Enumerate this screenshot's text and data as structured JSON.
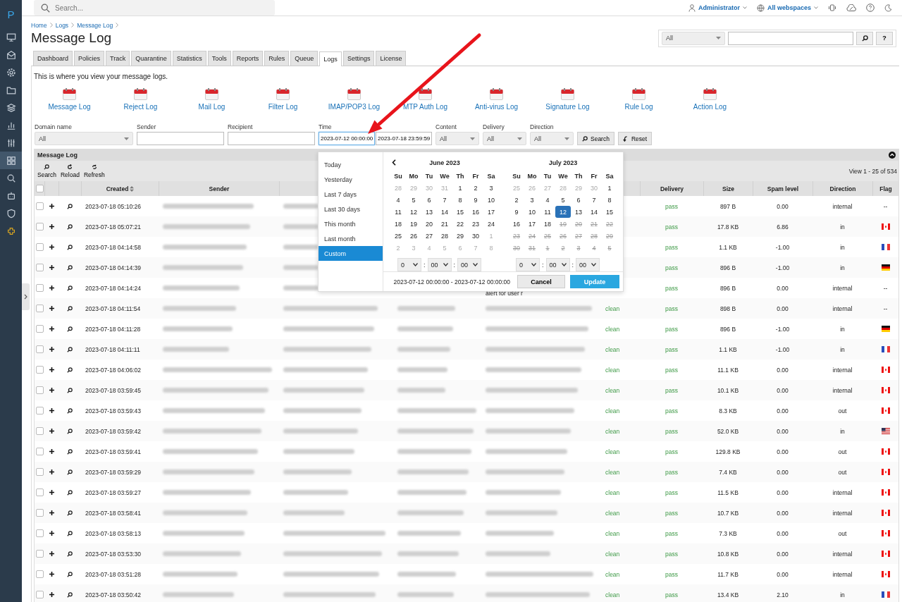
{
  "sidebar": {
    "logo": "P",
    "items": [
      {
        "kind": "monitor",
        "selected": false
      },
      {
        "kind": "inbox",
        "selected": false
      },
      {
        "kind": "gear",
        "selected": false
      },
      {
        "kind": "folder",
        "selected": false
      },
      {
        "kind": "layers",
        "selected": false
      },
      {
        "kind": "chart",
        "selected": false
      },
      {
        "kind": "sliders",
        "selected": false
      },
      {
        "kind": "grid",
        "selected": true
      },
      {
        "kind": "search",
        "selected": false
      },
      {
        "kind": "robot",
        "selected": false
      },
      {
        "kind": "shield",
        "selected": false
      },
      {
        "kind": "puzzle",
        "selected": false
      }
    ]
  },
  "topbar": {
    "search": {
      "placeholder": "Search..."
    },
    "user": "Administrator",
    "webspace": "All webspaces"
  },
  "breadcrumb": [
    "Home",
    "Logs",
    "Message Log"
  ],
  "title": "Message Log",
  "quick_search": {
    "scope": "All",
    "help": "?"
  },
  "tabs": [
    {
      "label": "Dashboard",
      "selected": false
    },
    {
      "label": "Policies",
      "selected": false
    },
    {
      "label": "Track",
      "selected": false
    },
    {
      "label": "Quarantine",
      "selected": false
    },
    {
      "label": "Statistics",
      "selected": false
    },
    {
      "label": "Tools",
      "selected": false
    },
    {
      "label": "Reports",
      "selected": false
    },
    {
      "label": "Rules",
      "selected": false
    },
    {
      "label": "Queue",
      "selected": false
    },
    {
      "label": "Logs",
      "selected": true
    },
    {
      "label": "Settings",
      "selected": false
    },
    {
      "label": "License",
      "selected": false
    }
  ],
  "intro": "This is where you view your message logs.",
  "log_types": [
    "Message Log",
    "Reject Log",
    "Mail Log",
    "Filter Log",
    "IMAP/POP3 Log",
    "MTP Auth Log",
    "Anti-virus Log",
    "Signature Log",
    "Rule Log",
    "Action Log"
  ],
  "filters": {
    "domain": {
      "label": "Domain name",
      "value": "All"
    },
    "sender": {
      "label": "Sender"
    },
    "recipient": {
      "label": "Recipient"
    },
    "time": {
      "label": "Time",
      "from": "2023-07-12 00:00:00",
      "to": "2023-07-18 23:59:59"
    },
    "content": {
      "label": "Content",
      "value": "All"
    },
    "delivery": {
      "label": "Delivery",
      "value": "All"
    },
    "direction": {
      "label": "Direction",
      "value": "All"
    },
    "search_button": "Search",
    "reset_button": "Reset"
  },
  "date_picker": {
    "presets": [
      {
        "label": "Today",
        "selected": false
      },
      {
        "label": "Yesterday",
        "selected": false
      },
      {
        "label": "Last 7 days",
        "selected": false
      },
      {
        "label": "Last 30 days",
        "selected": false
      },
      {
        "label": "This month",
        "selected": false
      },
      {
        "label": "Last month",
        "selected": false
      },
      {
        "label": "Custom",
        "selected": true
      }
    ],
    "months": [
      {
        "title": "June 2023",
        "weekdays": [
          "Su",
          "Mo",
          "Tu",
          "We",
          "Th",
          "Fr",
          "Sa"
        ],
        "time": [
          {
            "kind": "select",
            "text": "0"
          },
          {
            "kind": "separator",
            "text": ":"
          },
          {
            "kind": "select",
            "text": "00"
          },
          {
            "kind": "separator",
            "text": ":"
          },
          {
            "kind": "select",
            "text": "00"
          }
        ],
        "days": [
          {
            "day": "28",
            "other_month": true,
            "disabled": false,
            "selected": false
          },
          {
            "day": "29",
            "other_month": true,
            "disabled": false,
            "selected": false
          },
          {
            "day": "30",
            "other_month": true,
            "disabled": false,
            "selected": false
          },
          {
            "day": "31",
            "other_month": true,
            "disabled": false,
            "selected": false
          },
          {
            "day": "1",
            "other_month": false,
            "disabled": false,
            "selected": false
          },
          {
            "day": "2",
            "other_month": false,
            "disabled": false,
            "selected": false
          },
          {
            "day": "3",
            "other_month": false,
            "disabled": false,
            "selected": false
          },
          {
            "day": "4",
            "other_month": false,
            "disabled": false,
            "selected": false
          },
          {
            "day": "5",
            "other_month": false,
            "disabled": false,
            "selected": false
          },
          {
            "day": "6",
            "other_month": false,
            "disabled": false,
            "selected": false
          },
          {
            "day": "7",
            "other_month": false,
            "disabled": false,
            "selected": false
          },
          {
            "day": "8",
            "other_month": false,
            "disabled": false,
            "selected": false
          },
          {
            "day": "9",
            "other_month": false,
            "disabled": false,
            "selected": false
          },
          {
            "day": "10",
            "other_month": false,
            "disabled": false,
            "selected": false
          },
          {
            "day": "11",
            "other_month": false,
            "disabled": false,
            "selected": false
          },
          {
            "day": "12",
            "other_month": false,
            "disabled": false,
            "selected": false
          },
          {
            "day": "13",
            "other_month": false,
            "disabled": false,
            "selected": false
          },
          {
            "day": "14",
            "other_month": false,
            "disabled": false,
            "selected": false
          },
          {
            "day": "15",
            "other_month": false,
            "disabled": false,
            "selected": false
          },
          {
            "day": "16",
            "other_month": false,
            "disabled": false,
            "selected": false
          },
          {
            "day": "17",
            "other_month": false,
            "disabled": false,
            "selected": false
          },
          {
            "day": "18",
            "other_month": false,
            "disabled": false,
            "selected": false
          },
          {
            "day": "19",
            "other_month": false,
            "disabled": false,
            "selected": false
          },
          {
            "day": "20",
            "other_month": false,
            "disabled": false,
            "selected": false
          },
          {
            "day": "21",
            "other_month": false,
            "disabled": false,
            "selected": false
          },
          {
            "day": "22",
            "other_month": false,
            "disabled": false,
            "selected": false
          },
          {
            "day": "23",
            "other_month": false,
            "disabled": false,
            "selected": false
          },
          {
            "day": "24",
            "other_month": false,
            "disabled": false,
            "selected": false
          },
          {
            "day": "25",
            "other_month": false,
            "disabled": false,
            "selected": false
          },
          {
            "day": "26",
            "other_month": false,
            "disabled": false,
            "selected": false
          },
          {
            "day": "27",
            "other_month": false,
            "disabled": false,
            "selected": false
          },
          {
            "day": "28",
            "other_month": false,
            "disabled": false,
            "selected": false
          },
          {
            "day": "29",
            "other_month": false,
            "disabled": false,
            "selected": false
          },
          {
            "day": "30",
            "other_month": false,
            "disabled": false,
            "selected": false
          },
          {
            "day": "1",
            "other_month": true,
            "disabled": false,
            "selected": false
          },
          {
            "day": "2",
            "other_month": true,
            "disabled": false,
            "selected": false
          },
          {
            "day": "3",
            "other_month": true,
            "disabled": false,
            "selected": false
          },
          {
            "day": "4",
            "other_month": true,
            "disabled": false,
            "selected": false
          },
          {
            "day": "5",
            "other_month": true,
            "disabled": false,
            "selected": false
          },
          {
            "day": "6",
            "other_month": true,
            "disabled": false,
            "selected": false
          },
          {
            "day": "7",
            "other_month": true,
            "disabled": false,
            "selected": false
          },
          {
            "day": "8",
            "other_month": true,
            "disabled": false,
            "selected": false
          }
        ]
      },
      {
        "title": "July 2023",
        "weekdays": [
          "Su",
          "Mo",
          "Tu",
          "We",
          "Th",
          "Fr",
          "Sa"
        ],
        "time": [
          {
            "kind": "select",
            "text": "0"
          },
          {
            "kind": "separator",
            "text": ":"
          },
          {
            "kind": "select",
            "text": "00"
          },
          {
            "kind": "separator",
            "text": ":"
          },
          {
            "kind": "select",
            "text": "00"
          }
        ],
        "days": [
          {
            "day": "25",
            "other_month": true,
            "disabled": false,
            "selected": false
          },
          {
            "day": "26",
            "other_month": true,
            "disabled": false,
            "selected": false
          },
          {
            "day": "27",
            "other_month": true,
            "disabled": false,
            "selected": false
          },
          {
            "day": "28",
            "other_month": true,
            "disabled": false,
            "selected": false
          },
          {
            "day": "29",
            "other_month": true,
            "disabled": false,
            "selected": false
          },
          {
            "day": "30",
            "other_month": true,
            "disabled": false,
            "selected": false
          },
          {
            "day": "1",
            "other_month": false,
            "disabled": false,
            "selected": false
          },
          {
            "day": "2",
            "other_month": false,
            "disabled": false,
            "selected": false
          },
          {
            "day": "3",
            "other_month": false,
            "disabled": false,
            "selected": false
          },
          {
            "day": "4",
            "other_month": false,
            "disabled": false,
            "selected": false
          },
          {
            "day": "5",
            "other_month": false,
            "disabled": false,
            "selected": false
          },
          {
            "day": "6",
            "other_month": false,
            "disabled": false,
            "selected": false
          },
          {
            "day": "7",
            "other_month": false,
            "disabled": false,
            "selected": false
          },
          {
            "day": "8",
            "other_month": false,
            "disabled": false,
            "selected": false
          },
          {
            "day": "9",
            "other_month": false,
            "disabled": false,
            "selected": false
          },
          {
            "day": "10",
            "other_month": false,
            "disabled": false,
            "selected": false
          },
          {
            "day": "11",
            "other_month": false,
            "disabled": false,
            "selected": false
          },
          {
            "day": "12",
            "other_month": false,
            "disabled": false,
            "selected": true
          },
          {
            "day": "13",
            "other_month": false,
            "disabled": false,
            "selected": false
          },
          {
            "day": "14",
            "other_month": false,
            "disabled": false,
            "selected": false
          },
          {
            "day": "15",
            "other_month": false,
            "disabled": false,
            "selected": false
          },
          {
            "day": "16",
            "other_month": false,
            "disabled": false,
            "selected": false
          },
          {
            "day": "17",
            "other_month": false,
            "disabled": false,
            "selected": false
          },
          {
            "day": "18",
            "other_month": false,
            "disabled": false,
            "selected": false
          },
          {
            "day": "19",
            "other_month": false,
            "disabled": true,
            "selected": false
          },
          {
            "day": "20",
            "other_month": false,
            "disabled": true,
            "selected": false
          },
          {
            "day": "21",
            "other_month": false,
            "disabled": true,
            "selected": false
          },
          {
            "day": "22",
            "other_month": false,
            "disabled": true,
            "selected": false
          },
          {
            "day": "23",
            "other_month": false,
            "disabled": true,
            "selected": false
          },
          {
            "day": "24",
            "other_month": false,
            "disabled": true,
            "selected": false
          },
          {
            "day": "25",
            "other_month": false,
            "disabled": true,
            "selected": false
          },
          {
            "day": "26",
            "other_month": false,
            "disabled": true,
            "selected": false
          },
          {
            "day": "27",
            "other_month": false,
            "disabled": true,
            "selected": false
          },
          {
            "day": "28",
            "other_month": false,
            "disabled": true,
            "selected": false
          },
          {
            "day": "29",
            "other_month": false,
            "disabled": true,
            "selected": false
          },
          {
            "day": "30",
            "other_month": false,
            "disabled": true,
            "selected": false
          },
          {
            "day": "31",
            "other_month": false,
            "disabled": true,
            "selected": false
          },
          {
            "day": "1",
            "other_month": true,
            "disabled": true,
            "selected": false
          },
          {
            "day": "2",
            "other_month": true,
            "disabled": true,
            "selected": false
          },
          {
            "day": "3",
            "other_month": true,
            "disabled": true,
            "selected": false
          },
          {
            "day": "4",
            "other_month": true,
            "disabled": true,
            "selected": false
          },
          {
            "day": "5",
            "other_month": true,
            "disabled": true,
            "selected": false
          }
        ]
      }
    ],
    "range": "2023-07-12 00:00:00 - 2023-07-12 00:00:00",
    "cancel": "Cancel",
    "update": "Update"
  },
  "grid": {
    "title": "Message Log",
    "toolbar": [
      {
        "kind": "search",
        "label": "Search"
      },
      {
        "kind": "reload",
        "label": "Reload"
      },
      {
        "kind": "refresh",
        "label": "Refresh"
      }
    ],
    "pager": "View 1 - 25 of 534",
    "select_all": {
      "checked": false
    },
    "columns": [
      {
        "label": "Created",
        "sortable": true
      },
      {
        "label": "Sender",
        "sortable": false
      },
      {
        "label": "Delivery",
        "sortable": false
      },
      {
        "label": "Size",
        "sortable": false
      },
      {
        "label": "Spam level",
        "sortable": false
      },
      {
        "label": "Direction",
        "sortable": false
      },
      {
        "label": "Flag",
        "sortable": false
      }
    ],
    "rows": [
      {
        "checked": false,
        "created": "2023-07-18 05:10:26",
        "delivery": "pass",
        "size": "897 B",
        "spam": "0.00",
        "direction": "internal",
        "flag": {
          "kind": "none",
          "text": "--"
        }
      },
      {
        "checked": false,
        "created": "2023-07-18 05:07:21",
        "delivery": "pass",
        "size": "17.8 KB",
        "spam": "6.86",
        "direction": "in",
        "flag": {
          "kind": "ca"
        }
      },
      {
        "checked": false,
        "created": "2023-07-18 04:14:58",
        "delivery": "pass",
        "size": "1.1 KB",
        "spam": "-1.00",
        "direction": "in",
        "flag": {
          "kind": "fr"
        }
      },
      {
        "checked": false,
        "created": "2023-07-18 04:14:39",
        "delivery": "pass",
        "size": "896 B",
        "spam": "-1.00",
        "direction": "in",
        "flag": {
          "kind": "de"
        }
      },
      {
        "checked": false,
        "created": "2023-07-18 04:14:24",
        "subject": "alert for user r",
        "delivery": "pass",
        "size": "896 B",
        "spam": "0.00",
        "direction": "internal",
        "flag": {
          "kind": "none",
          "text": "--"
        }
      },
      {
        "checked": false,
        "created": "2023-07-18 04:11:54",
        "content": "clean",
        "delivery": "pass",
        "size": "898 B",
        "spam": "0.00",
        "direction": "internal",
        "flag": {
          "kind": "none",
          "text": "--"
        }
      },
      {
        "checked": false,
        "created": "2023-07-18 04:11:28",
        "content": "clean",
        "delivery": "pass",
        "size": "896 B",
        "spam": "-1.00",
        "direction": "in",
        "flag": {
          "kind": "de"
        }
      },
      {
        "checked": false,
        "created": "2023-07-18 04:11:11",
        "content": "clean",
        "delivery": "pass",
        "size": "1.1 KB",
        "spam": "-1.00",
        "direction": "in",
        "flag": {
          "kind": "fr"
        }
      },
      {
        "checked": false,
        "created": "2023-07-18 04:06:02",
        "content": "clean",
        "delivery": "pass",
        "size": "11.1 KB",
        "spam": "0.00",
        "direction": "internal",
        "flag": {
          "kind": "ca"
        }
      },
      {
        "checked": false,
        "created": "2023-07-18 03:59:45",
        "content": "clean",
        "delivery": "pass",
        "size": "10.1 KB",
        "spam": "0.00",
        "direction": "internal",
        "flag": {
          "kind": "ca"
        }
      },
      {
        "checked": false,
        "created": "2023-07-18 03:59:43",
        "content": "clean",
        "delivery": "pass",
        "size": "8.3 KB",
        "spam": "0.00",
        "direction": "out",
        "flag": {
          "kind": "ca"
        }
      },
      {
        "checked": false,
        "created": "2023-07-18 03:59:42",
        "content": "clean",
        "delivery": "pass",
        "size": "52.0 KB",
        "spam": "0.00",
        "direction": "in",
        "flag": {
          "kind": "us"
        }
      },
      {
        "checked": false,
        "created": "2023-07-18 03:59:41",
        "content": "clean",
        "delivery": "pass",
        "size": "129.8 KB",
        "spam": "0.00",
        "direction": "out",
        "flag": {
          "kind": "ca"
        }
      },
      {
        "checked": false,
        "created": "2023-07-18 03:59:29",
        "content": "clean",
        "delivery": "pass",
        "size": "7.4 KB",
        "spam": "0.00",
        "direction": "out",
        "flag": {
          "kind": "ca"
        }
      },
      {
        "checked": false,
        "created": "2023-07-18 03:59:27",
        "content": "clean",
        "delivery": "pass",
        "size": "11.5 KB",
        "spam": "0.00",
        "direction": "internal",
        "flag": {
          "kind": "ca"
        }
      },
      {
        "checked": false,
        "created": "2023-07-18 03:58:41",
        "content": "clean",
        "delivery": "pass",
        "size": "10.7 KB",
        "spam": "0.00",
        "direction": "internal",
        "flag": {
          "kind": "ca"
        }
      },
      {
        "checked": false,
        "created": "2023-07-18 03:58:13",
        "content": "clean",
        "delivery": "pass",
        "size": "7.3 KB",
        "spam": "0.00",
        "direction": "out",
        "flag": {
          "kind": "ca"
        }
      },
      {
        "checked": false,
        "created": "2023-07-18 03:53:30",
        "content": "clean",
        "delivery": "pass",
        "size": "10.8 KB",
        "spam": "0.00",
        "direction": "internal",
        "flag": {
          "kind": "ca"
        }
      },
      {
        "checked": false,
        "created": "2023-07-18 03:51:28",
        "content": "clean",
        "delivery": "pass",
        "size": "11.7 KB",
        "spam": "0.00",
        "direction": "internal",
        "flag": {
          "kind": "ca"
        }
      },
      {
        "checked": false,
        "created": "2023-07-18 03:50:42",
        "content": "clean",
        "delivery": "pass",
        "size": "13.4 KB",
        "spam": "2.10",
        "direction": "in",
        "flag": {
          "kind": "fr"
        }
      }
    ]
  }
}
